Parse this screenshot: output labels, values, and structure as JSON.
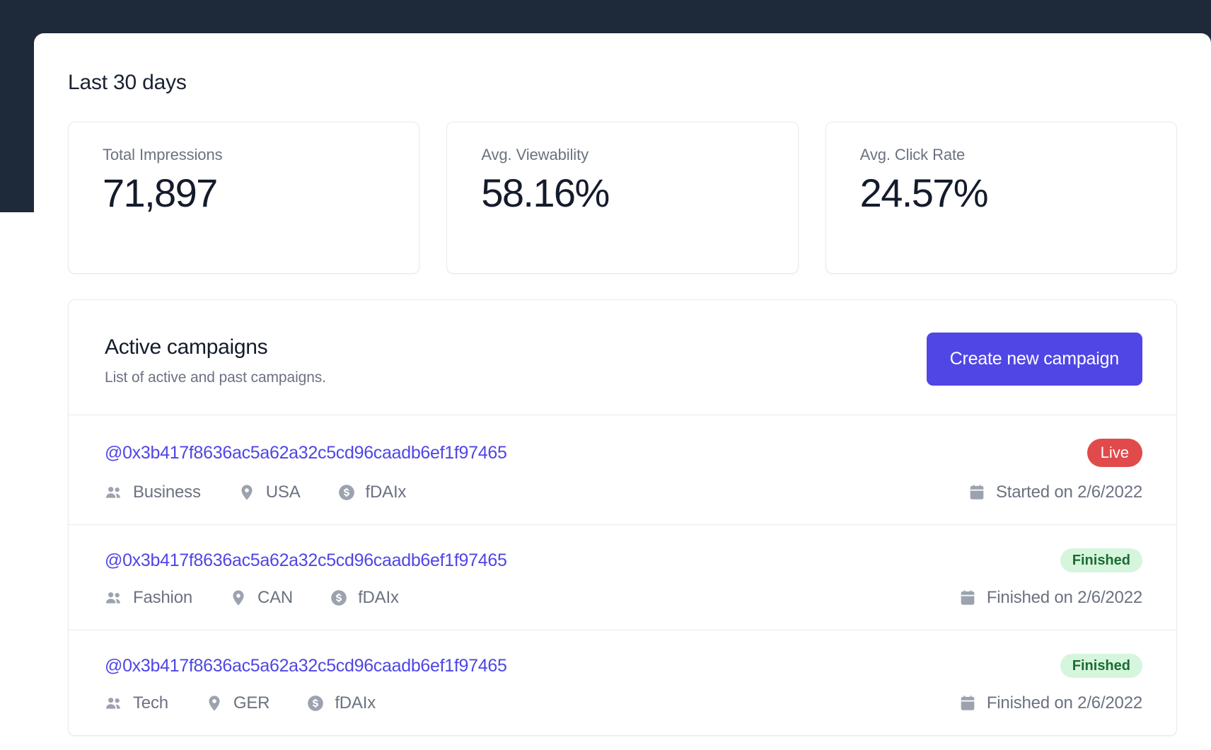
{
  "page": {
    "title": "Last 30 days"
  },
  "stats": [
    {
      "label": "Total Impressions",
      "value": "71,897"
    },
    {
      "label": "Avg. Viewability",
      "value": "58.16%"
    },
    {
      "label": "Avg. Click Rate",
      "value": "24.57%"
    }
  ],
  "campaigns_section": {
    "title": "Active campaigns",
    "subtitle": "List of active and past campaigns.",
    "create_button_label": "Create new campaign"
  },
  "campaigns": [
    {
      "address": "@0x3b417f8636ac5a62a32c5cd96caadb6ef1f97465",
      "status": "Live",
      "status_kind": "live",
      "audience": "Business",
      "region": "USA",
      "currency": "fDAIx",
      "date_text": "Started on 2/6/2022"
    },
    {
      "address": "@0x3b417f8636ac5a62a32c5cd96caadb6ef1f97465",
      "status": "Finished",
      "status_kind": "finished",
      "audience": "Fashion",
      "region": "CAN",
      "currency": "fDAIx",
      "date_text": "Finished on 2/6/2022"
    },
    {
      "address": "@0x3b417f8636ac5a62a32c5cd96caadb6ef1f97465",
      "status": "Finished",
      "status_kind": "finished",
      "audience": "Tech",
      "region": "GER",
      "currency": "fDAIx",
      "date_text": "Finished on 2/6/2022"
    }
  ],
  "colors": {
    "header_band": "#1e2939",
    "accent": "#4f46e5",
    "live_badge": "#e04a4a",
    "finished_badge_bg": "#d6f5dd",
    "finished_badge_text": "#1c6b33",
    "muted_text": "#6b7280",
    "icon": "#9ca3af"
  },
  "icons": {
    "audience": "users-icon",
    "region": "location-pin-icon",
    "currency": "dollar-circle-icon",
    "date": "calendar-icon"
  }
}
